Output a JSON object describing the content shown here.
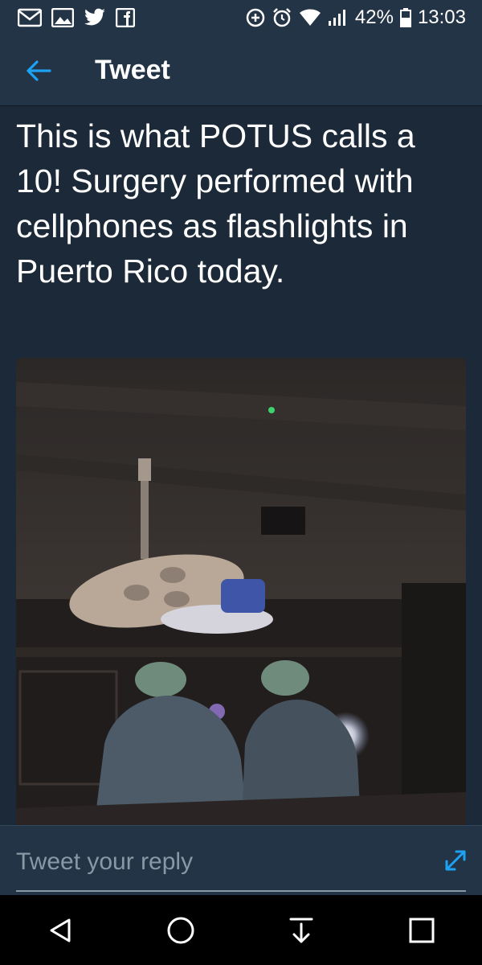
{
  "status_bar": {
    "battery_percent": "42%",
    "time": "13:03",
    "left_icons": [
      "gmail-icon",
      "gallery-icon",
      "twitter-icon",
      "facebook-icon"
    ],
    "right_icons": [
      "data-saver-icon",
      "alarm-icon",
      "wifi-icon",
      "signal-icon",
      "battery-icon"
    ]
  },
  "header": {
    "title": "Tweet"
  },
  "tweet": {
    "text": "This is what POTUS calls a 10! Surgery performed with cellphones as flashlights in Puerto Rico today."
  },
  "reply": {
    "placeholder": "Tweet your reply"
  },
  "colors": {
    "background": "#1c2938",
    "bar": "#243447",
    "accent": "#1da1f2",
    "muted": "#8899a6"
  },
  "nav": {
    "buttons": [
      "back-triangle-icon",
      "home-circle-icon",
      "download-icon",
      "recents-square-icon"
    ]
  }
}
